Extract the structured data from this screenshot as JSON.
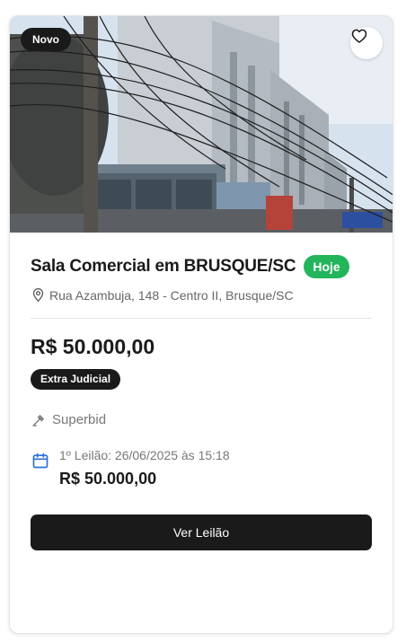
{
  "listing": {
    "badge_new": "Novo",
    "title": "Sala Comercial em BRUSQUE/SC",
    "badge_when": "Hoje",
    "address": "Rua Azambuja, 148 - Centro II, Brusque/SC",
    "price": "R$ 50.000,00",
    "type_badge": "Extra Judicial",
    "source": "Superbid",
    "auction": {
      "date_label": "1º Leilão: 26/06/2025 às 15:18",
      "price": "R$ 50.000,00"
    },
    "cta_label": "Ver Leilão"
  },
  "icons": {
    "favorite": "heart-icon",
    "location": "map-pin-icon",
    "source": "gavel-icon",
    "calendar": "calendar-icon"
  },
  "colors": {
    "accent_dark": "#1a1a1a",
    "badge_green": "#22b55b",
    "calendar_blue": "#2f6fdb",
    "muted_text": "#777777"
  }
}
